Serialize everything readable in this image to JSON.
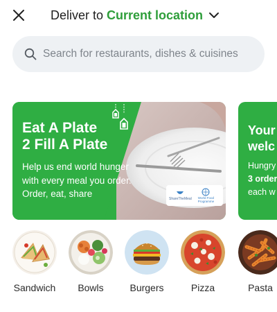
{
  "header": {
    "deliver_prefix": "Deliver to",
    "location": "Current location",
    "accent_color": "#2e9e3a"
  },
  "search": {
    "placeholder": "Search for restaurants, dishes & cuisines"
  },
  "banners": [
    {
      "title_line1": "Eat A Plate",
      "title_line2": "2 Fill A Plate",
      "subtitle_line1": "Help us end world hunger",
      "subtitle_line2": "with every meal you order.",
      "subtitle_line3": "Order, eat, share",
      "badge_left": "ShareTheMeal",
      "badge_right": "World Food Programme",
      "bg_color": "#2fae43"
    },
    {
      "title_line1": "Your",
      "title_line2": "welc",
      "subtitle_line1": "Hungry",
      "subtitle_line2": "3 order",
      "subtitle_line3": "each w",
      "bg_color": "#2fae43"
    }
  ],
  "categories": [
    {
      "label": "Sandwich",
      "icon": "sandwich-image"
    },
    {
      "label": "Bowls",
      "icon": "bowl-image"
    },
    {
      "label": "Burgers",
      "icon": "burger-image"
    },
    {
      "label": "Pizza",
      "icon": "pizza-image"
    },
    {
      "label": "Pasta",
      "icon": "pasta-image"
    }
  ]
}
